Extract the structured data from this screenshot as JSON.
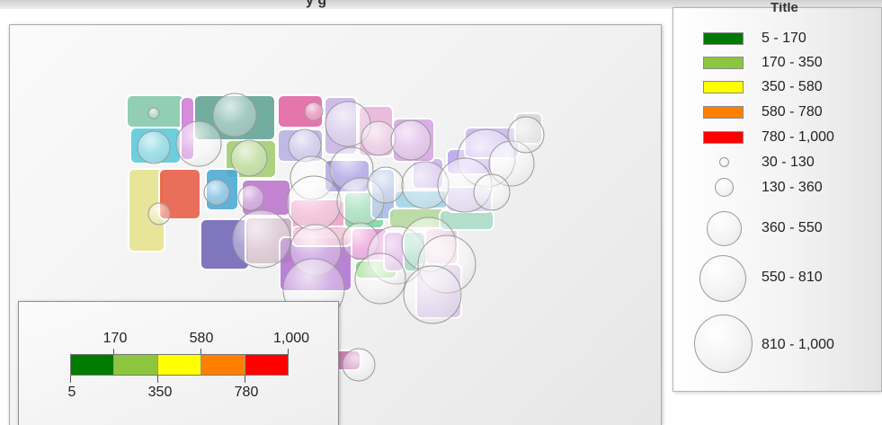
{
  "map": {
    "title_fragment": "y       g",
    "regions": [
      {
        "name": "state-wa",
        "color": "#7fc7a8"
      },
      {
        "name": "state-id",
        "color": "#d07ad8"
      },
      {
        "name": "state-mt",
        "color": "#5aa08f"
      },
      {
        "name": "state-nd",
        "color": "#e05fa0"
      },
      {
        "name": "state-mn",
        "color": "#c7b1e3"
      },
      {
        "name": "state-or",
        "color": "#55c7d8"
      },
      {
        "name": "state-wy",
        "color": "#9dcc6a"
      },
      {
        "name": "state-sd",
        "color": "#b6aee0"
      },
      {
        "name": "state-ca",
        "color": "#e5e08a"
      },
      {
        "name": "state-nv",
        "color": "#e8573f"
      },
      {
        "name": "state-ut",
        "color": "#45a6d4"
      },
      {
        "name": "state-co",
        "color": "#b86fc9"
      },
      {
        "name": "state-ks",
        "color": "#f0a0c8"
      },
      {
        "name": "state-az",
        "color": "#6b5fb3"
      },
      {
        "name": "state-nm",
        "color": "#c8a8b8"
      },
      {
        "name": "state-tx",
        "color": "#b06fd0"
      },
      {
        "name": "state-ok",
        "color": "#f2c3d6"
      },
      {
        "name": "state-ia",
        "color": "#8c79d8"
      },
      {
        "name": "state-mo",
        "color": "#7dd3a0"
      },
      {
        "name": "state-ar",
        "color": "#e87fd1"
      },
      {
        "name": "state-la",
        "color": "#7ed36b"
      },
      {
        "name": "state-il",
        "color": "#a4b9e6"
      },
      {
        "name": "state-ms",
        "color": "#d084d6"
      },
      {
        "name": "state-al",
        "color": "#70c8a3"
      },
      {
        "name": "state-tn",
        "color": "#b3d89a"
      },
      {
        "name": "state-ky",
        "color": "#9fd3e6"
      },
      {
        "name": "state-ga",
        "color": "#e9c6d8"
      },
      {
        "name": "state-fl",
        "color": "#d9c3e8"
      },
      {
        "name": "state-oh",
        "color": "#c8b2e6"
      },
      {
        "name": "state-mi",
        "color": "#d4a4e0"
      },
      {
        "name": "state-wi",
        "color": "#e6b1d9"
      },
      {
        "name": "state-pa",
        "color": "#b9a3ec"
      },
      {
        "name": "state-ny",
        "color": "#c6b6ee"
      },
      {
        "name": "state-nc",
        "color": "#a8dbc6"
      },
      {
        "name": "state-va",
        "color": "#dcd2ef"
      },
      {
        "name": "state-me",
        "color": "#d6d6d6"
      },
      {
        "name": "state-hi",
        "color": "#c46aa8"
      }
    ]
  },
  "legend": {
    "title": "Títle",
    "colors": [
      {
        "label": "5 - 170",
        "color": "#007a00"
      },
      {
        "label": "170 - 350",
        "color": "#8cc63f"
      },
      {
        "label": "350 - 580",
        "color": "#ffff00"
      },
      {
        "label": "580 - 780",
        "color": "#ff8000"
      },
      {
        "label": "780 - 1,000",
        "color": "#ff0000"
      }
    ],
    "sizes": [
      {
        "label": "30 - 130"
      },
      {
        "label": "130 - 360"
      },
      {
        "label": "360 - 550"
      },
      {
        "label": "550 - 810"
      },
      {
        "label": "810 - 1,000"
      }
    ]
  },
  "scale": {
    "colors": [
      "#007a00",
      "#8cc63f",
      "#ffff00",
      "#ff8000",
      "#ff0000"
    ],
    "top_labels": [
      "170",
      "580",
      "1,000"
    ],
    "bottom_labels": [
      "5",
      "350",
      "780"
    ]
  }
}
